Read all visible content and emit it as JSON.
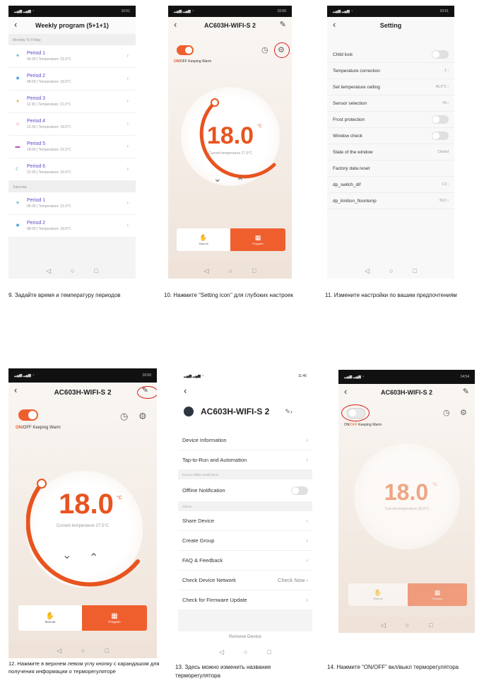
{
  "status_times": {
    "p9": "10:51",
    "p10": "10:50",
    "p11": "10:51",
    "p12": "10:50",
    "p13": "11:46",
    "p14": "14:54"
  },
  "weekly": {
    "title": "Weekly program (5+1+1)",
    "sections": [
      {
        "label": "Monday To Friday",
        "periods": [
          {
            "name": "Period 1",
            "detail": "06:30 | Temperature: 21.0°C",
            "icon": "sunrise-icon",
            "color": "#3bb0a8"
          },
          {
            "name": "Period 2",
            "detail": "08:00 | Temperature: 18.0°C",
            "icon": "sun-icon",
            "color": "#4aa3e0"
          },
          {
            "name": "Period 3",
            "detail": "11:30 | Temperature: 21.0°C",
            "icon": "person-icon",
            "color": "#f2a93b"
          },
          {
            "name": "Period 4",
            "detail": "12:30 | Temperature: 18.0°C",
            "icon": "home-icon",
            "color": "#e25555"
          },
          {
            "name": "Period 5",
            "detail": "18:00 | Temperature: 21.0°C",
            "icon": "sofa-icon",
            "color": "#b85ab8"
          },
          {
            "name": "Period 6",
            "detail": "22:30 | Temperature: 16.0°C",
            "icon": "moon-icon",
            "color": "#3a9ec7"
          }
        ]
      },
      {
        "label": "Saturday",
        "periods": [
          {
            "name": "Period 1",
            "detail": "06:30 | Temperature: 21.0°C",
            "icon": "sunrise-icon",
            "color": "#3bb0a8"
          },
          {
            "name": "Period 2",
            "detail": "08:00 | Temperature: 18.0°C",
            "icon": "sun-icon",
            "color": "#4aa3e0"
          }
        ]
      }
    ]
  },
  "device_title": "AC603H-WIFI-S 2",
  "on_label": "ON",
  "off_label": "/OFF",
  "keeping_warm": "Keeping Warm",
  "set_temp": "18.0",
  "temp_unit": "°C",
  "current_temp": "Current temperature 27.5°C",
  "current_temp_off": "Current temperature 26.0°C",
  "mode_manual": "Manual",
  "mode_program": "Program",
  "setting": {
    "title": "Setting",
    "rows": [
      {
        "label": "Child lock",
        "type": "toggle"
      },
      {
        "label": "Temperature correction",
        "value": "-1"
      },
      {
        "label": "Set temperature ceiling",
        "value": "45.0°C"
      },
      {
        "label": "Sensor selection",
        "value": "IN"
      },
      {
        "label": "Frost protection",
        "type": "toggle"
      },
      {
        "label": "Window check",
        "type": "toggle"
      },
      {
        "label": "State of the window",
        "value": "Closed"
      },
      {
        "label": "Factory data reset"
      },
      {
        "label": "dp_switch_dif",
        "value": "1.0"
      },
      {
        "label": "dp_limition_floortemp",
        "value": "50.0"
      }
    ]
  },
  "info": {
    "title": "AC603H-WIFI-S 2",
    "device_information": "Device Information",
    "tap_to_run": "Tap-to-Run and Automation",
    "offline_head": "Device Offline Notification",
    "offline_notification": "Offline Notification",
    "others_head": "Others",
    "share": "Share Device",
    "create_group": "Create Group",
    "faq": "FAQ & Feedback",
    "check_network": "Check Device Network",
    "check_now": "Check Now",
    "firmware": "Check for Firmware Update",
    "remove": "Remove Device"
  },
  "captions": {
    "c9": "9. Задайте время и температуру периодов",
    "c10": "10. Нажмите “Setting icon’’ для глубоких настроек",
    "c11": "11. Измените настройки по вашим предпочтениям",
    "c12": "12. Нажмите в верхнем левом углу кнопку с карандашом для получения информации о терморегуляторе",
    "c13": "13. Здесь можно изменить название терморегулятора",
    "c14": "14. Нажмите “ON/OFF” вкл/выкл терморегулятора"
  }
}
